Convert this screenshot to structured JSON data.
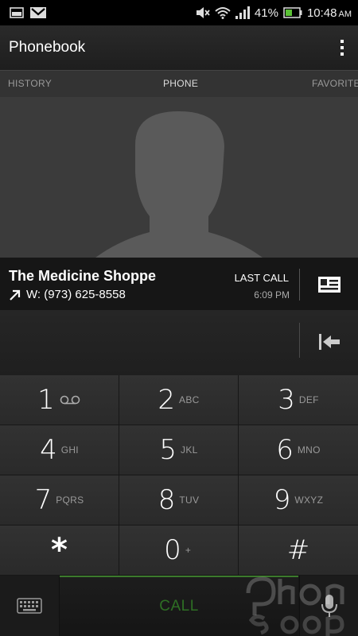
{
  "status_bar": {
    "battery_percent": "41%",
    "time": "10:48",
    "ampm": "AM",
    "icons": [
      "image-icon",
      "gmail-icon",
      "mute-icon",
      "wifi-icon",
      "signal-icon",
      "battery-icon"
    ]
  },
  "app_bar": {
    "title": "Phonebook",
    "overflow_icon": "overflow-menu-icon"
  },
  "tabs": [
    {
      "label": "HISTORY"
    },
    {
      "label": "PHONE"
    },
    {
      "label": "FAVORITES"
    }
  ],
  "contact": {
    "name": "The Medicine Shoppe",
    "number": "W: (973) 625-8558",
    "last_call_label": "LAST CALL",
    "last_call_time": "6:09 PM",
    "call_direction_icon": "outgoing-call-arrow-icon",
    "card_icon": "contact-card-icon"
  },
  "keypad": {
    "keys": [
      {
        "digit": "1",
        "letters": ""
      },
      {
        "digit": "2",
        "letters": "ABC"
      },
      {
        "digit": "3",
        "letters": "DEF"
      },
      {
        "digit": "4",
        "letters": "GHI"
      },
      {
        "digit": "5",
        "letters": "JKL"
      },
      {
        "digit": "6",
        "letters": "MNO"
      },
      {
        "digit": "7",
        "letters": "PQRS"
      },
      {
        "digit": "8",
        "letters": "TUV"
      },
      {
        "digit": "9",
        "letters": "WXYZ"
      },
      {
        "digit": "*",
        "letters": ""
      },
      {
        "digit": "0",
        "letters": "+"
      },
      {
        "digit": "#",
        "letters": ""
      }
    ],
    "voicemail_icon": "voicemail-icon"
  },
  "bottom_bar": {
    "call_label": "CALL",
    "keyboard_icon": "keyboard-icon",
    "mic_icon": "microphone-icon"
  },
  "colors": {
    "call_accent": "#3c7a2c",
    "battery_green": "#5bc236"
  }
}
